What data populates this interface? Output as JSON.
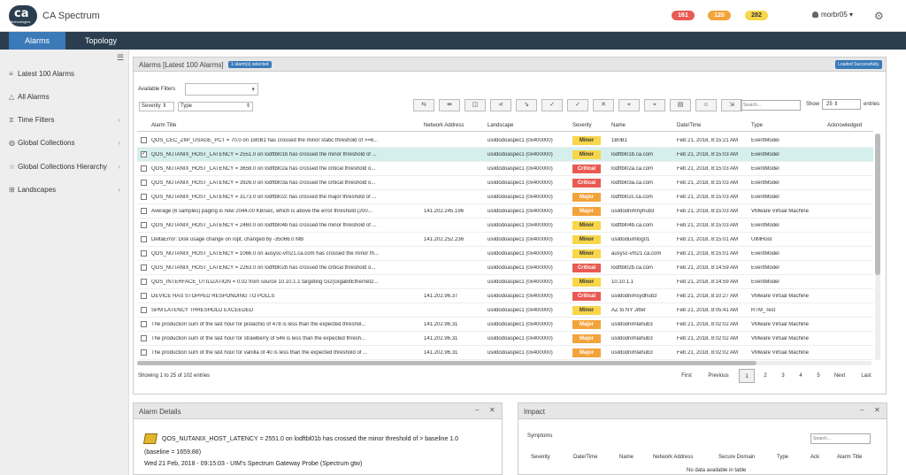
{
  "app": {
    "title": "CA Spectrum",
    "logo_text": "ca",
    "logo_sub": "technologies"
  },
  "header": {
    "badges": [
      {
        "value": "161",
        "color": "#e85a52"
      },
      {
        "value": "120",
        "color": "#f3a33b"
      },
      {
        "value": "282",
        "color": "#f7d64a"
      }
    ],
    "user": "morbr05"
  },
  "nav": {
    "tabs": [
      "Alarms",
      "Topology"
    ]
  },
  "sidebar": {
    "items": [
      {
        "label": "Latest 100 Alarms",
        "icon": "list-icon"
      },
      {
        "label": "All Alarms",
        "icon": "bell-icon"
      },
      {
        "label": "Time Filters",
        "icon": "hourglass-icon"
      },
      {
        "label": "Global Collections",
        "icon": "globe-icon"
      },
      {
        "label": "Global Collections Hierarchy",
        "icon": "star-icon"
      },
      {
        "label": "Landscapes",
        "icon": "hierarchy-icon"
      }
    ]
  },
  "alarms": {
    "title": "Alarms [Latest 100 Alarms]",
    "selected_badge": "1 alarm(s) selected",
    "loaded": "Loaded Successfully.",
    "available_filters_label": "Available Filters",
    "severity_filter": "Severity",
    "type_filter": "Type",
    "search_placeholder": "Search...",
    "show_label": "Show",
    "show_value": "25",
    "entries_label": "entries",
    "columns": [
      "Alarm Title",
      "Network Address",
      "Landscape",
      "Severity",
      "Name",
      "Date/Time",
      "Type",
      "Acknowledged"
    ],
    "rows": [
      {
        "title": "QOS_CEC_ZIIP_USAGE_PCT = 70.0 on 1B0B1 has crossed the minor static threshold of >=6...",
        "addr": "",
        "landscape": "usildodoaspec1 (0x400000)",
        "severity": "Minor",
        "name": "1B0B1",
        "datetime": "Feb 21, 2018, 8:15:21 AM",
        "type": "EventModel",
        "checked": false
      },
      {
        "title": "QOS_NUTANIX_HOST_LATENCY = 2551.0 on lodftbl01b has crossed the minor threshold of ...",
        "addr": "",
        "landscape": "usildodoaspec1 (0x400000)",
        "severity": "Minor",
        "name": "lodftbl01b.ca.com",
        "datetime": "Feb 21, 2018, 8:15:03 AM",
        "type": "EventModel",
        "checked": true
      },
      {
        "title": "QOS_NUTANIX_HOST_LATENCY = 3658.0 on lodftbl02a has crossed the critical threshold o...",
        "addr": "",
        "landscape": "usildodoaspec1 (0x400000)",
        "severity": "Critical",
        "name": "lodftbl02a.ca.com",
        "datetime": "Feb 21, 2018, 8:15:03 AM",
        "type": "EventModel",
        "checked": false
      },
      {
        "title": "QOS_NUTANIX_HOST_LATENCY = 3926.0 on lodftbl03a has crossed the critical threshold o...",
        "addr": "",
        "landscape": "usildodoaspec1 (0x400000)",
        "severity": "Critical",
        "name": "lodftbl03a.ca.com",
        "datetime": "Feb 21, 2018, 8:15:03 AM",
        "type": "EventModel",
        "checked": false
      },
      {
        "title": "QOS_NUTANIX_HOST_LATENCY = 3173.0 on lodftbl02c has crossed the major threshold of ...",
        "addr": "",
        "landscape": "usildodoaspec1 (0x400000)",
        "severity": "Major",
        "name": "lodftbl02c.ca.com",
        "datetime": "Feb 21, 2018, 8:15:03 AM",
        "type": "EventModel",
        "checked": false
      },
      {
        "title": "Average (6 samples) paging is now 2044.00 KB/sec, which is above the error threshold (200...",
        "addr": "141.202.245.196",
        "landscape": "usildodoaspec1 (0x400000)",
        "severity": "Major",
        "name": "usildodnimnyhub3",
        "datetime": "Feb 21, 2018, 8:15:03 AM",
        "type": "VMware Virtual Machine",
        "checked": false
      },
      {
        "title": "QOS_NUTANIX_HOST_LATENCY = 2460.0 on lodftbl04b has crossed the minor threshold of ...",
        "addr": "",
        "landscape": "usildodoaspec1 (0x400000)",
        "severity": "Minor",
        "name": "lodftbl04b.ca.com",
        "datetime": "Feb 21, 2018, 8:15:03 AM",
        "type": "EventModel",
        "checked": false
      },
      {
        "title": "DeltaError: Disk usage change on /opt, changed by -35066.0 MB",
        "addr": "141.202.252.236",
        "landscape": "usildodoaspec1 (0x400000)",
        "severity": "Minor",
        "name": "usildoduimlog01",
        "datetime": "Feb 21, 2018, 8:15:01 AM",
        "type": "UIMHost",
        "checked": false
      },
      {
        "title": "QOS_NUTANIX_HOST_LATENCY = 1066.0 on ausysc-vm21.ca.com has crossed the minor th...",
        "addr": "",
        "landscape": "usildodoaspec1 (0x400000)",
        "severity": "Minor",
        "name": "ausysc-vm21.ca.com",
        "datetime": "Feb 21, 2018, 8:15:01 AM",
        "type": "EventModel",
        "checked": false
      },
      {
        "title": "QOS_NUTANIX_HOST_LATENCY = 2263.0 on lodftbl02b has crossed the critical threshold o...",
        "addr": "",
        "landscape": "usildodoaspec1 (0x400000)",
        "severity": "Critical",
        "name": "lodftbl02b.ca.com",
        "datetime": "Feb 21, 2018, 8:14:59 AM",
        "type": "EventModel",
        "checked": false
      },
      {
        "title": "QOS_INTERFACE_UTILIZATION = 0.02 from source 10.10.1.1 targeting Gi2(GigabitEthernet2...",
        "addr": "",
        "landscape": "usildodoaspec1 (0x400000)",
        "severity": "Minor",
        "name": "10.10.1.1",
        "datetime": "Feb 21, 2018, 8:14:59 AM",
        "type": "EventModel",
        "checked": false
      },
      {
        "title": "DEVICE HAS STOPPED RESPONDING TO POLLS",
        "addr": "141.202.96.37",
        "landscape": "usildodoaspec1 (0x400000)",
        "severity": "Critical",
        "name": "usildodnimsydhub3",
        "datetime": "Feb 21, 2018, 8:10:27 AM",
        "type": "VMware Virtual Machine",
        "checked": false
      },
      {
        "title": "SPM LATENCY THRESHOLD EXCEEDED",
        "addr": "",
        "landscape": "usildodoaspec1 (0x400000)",
        "severity": "Minor",
        "name": "AZ to NY Jitter",
        "datetime": "Feb 21, 2018, 8:05:41 AM",
        "type": "RTM_Test",
        "checked": false
      },
      {
        "title": "The production sum of the last hour for pistachio of 478 is less than the expected threshol...",
        "addr": "141.202.96.31",
        "landscape": "usildodoaspec1 (0x400000)",
        "severity": "Major",
        "name": "usildodnimlahub3",
        "datetime": "Feb 21, 2018, 8:02:02 AM",
        "type": "VMware Virtual Machine",
        "checked": false
      },
      {
        "title": "The production sum of the last hour for strawberry of 546 is less than the expected thresh...",
        "addr": "141.202.96.31",
        "landscape": "usildodoaspec1 (0x400000)",
        "severity": "Major",
        "name": "usildodnimlahub3",
        "datetime": "Feb 21, 2018, 8:02:02 AM",
        "type": "VMware Virtual Machine",
        "checked": false
      },
      {
        "title": "The production sum of the last hour for vanilla of 40 is less than the expected threshold of ...",
        "addr": "141.202.96.31",
        "landscape": "usildodoaspec1 (0x400000)",
        "severity": "Major",
        "name": "usildodnimlahub3",
        "datetime": "Feb 21, 2018, 8:02:02 AM",
        "type": "VMware Virtual Machine",
        "checked": false
      }
    ],
    "showing": "Showing 1 to 25 of 102 entries",
    "pagination": [
      "First",
      "Previous",
      "1",
      "2",
      "3",
      "4",
      "5",
      "Next",
      "Last"
    ]
  },
  "details": {
    "title": "Alarm Details",
    "line1": "QOS_NUTANIX_HOST_LATENCY = 2551.0 on lodftbl01b has crossed the minor threshold of > baseline 1.0",
    "line2": "(baseline = 1659.88)",
    "line3": "Wed 21 Feb, 2018 - 09:15:03 - UIM's Spectrum Gateway Probe (Spectrum gtw)"
  },
  "impact": {
    "title": "Impact",
    "symptoms_label": "Symptoms",
    "search_placeholder": "Search...",
    "columns": [
      "Severity",
      "Date/Time",
      "Name",
      "Network Address",
      "Secure Domain",
      "Type",
      "Ack",
      "Alarm Title"
    ],
    "no_data": "No data available in table"
  },
  "colors": {
    "nav": "#2b3e50",
    "accent": "#3a7ab8",
    "minor": "#f7d64a",
    "major": "#f3a33b",
    "critical": "#e85a52",
    "selected_row": "#d4efec"
  }
}
